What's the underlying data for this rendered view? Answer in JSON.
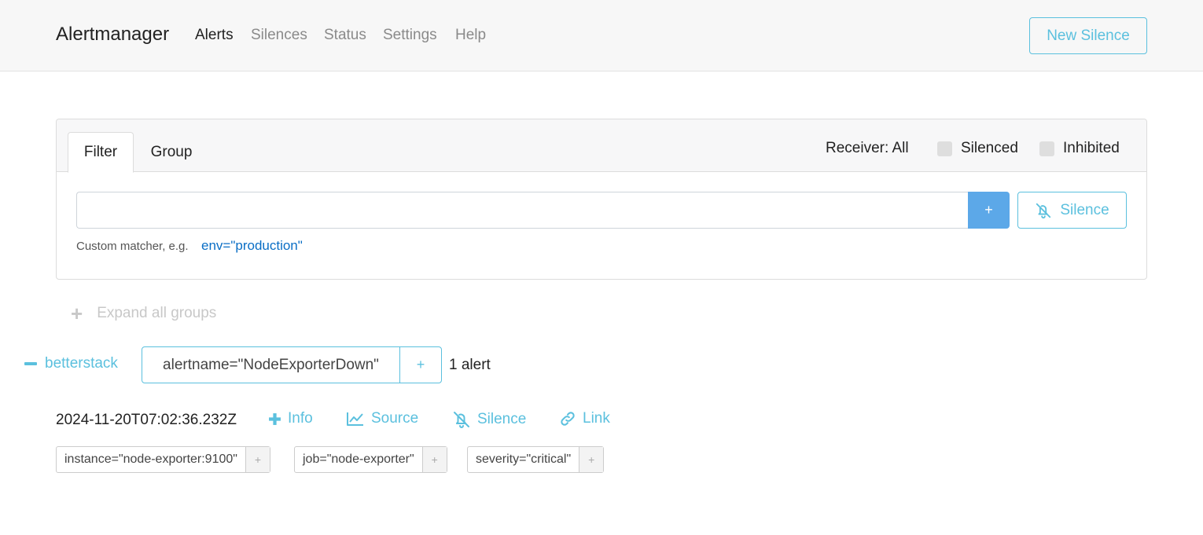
{
  "header": {
    "brand": "Alertmanager",
    "nav": [
      {
        "label": "Alerts",
        "active": true
      },
      {
        "label": "Silences",
        "active": false
      },
      {
        "label": "Status",
        "active": false
      },
      {
        "label": "Settings",
        "active": false
      },
      {
        "label": "Help",
        "active": false
      }
    ],
    "new_silence_label": "New Silence"
  },
  "filter_card": {
    "tabs": [
      {
        "label": "Filter",
        "active": true
      },
      {
        "label": "Group",
        "active": false
      }
    ],
    "receiver_label": "Receiver: All",
    "silenced_label": "Silenced",
    "inhibited_label": "Inhibited",
    "input_value": "",
    "input_placeholder": "",
    "add_button_label": "+",
    "silence_button_label": "Silence",
    "hint_text": "Custom matcher, e.g.",
    "hint_example": "env=\"production\""
  },
  "expand_all_label": "Expand all groups",
  "group": {
    "receiver": "betterstack",
    "label": "alertname=\"NodeExporterDown\"",
    "add_label": "+",
    "count": "1 alert"
  },
  "alert": {
    "timestamp": "2024-11-20T07:02:36.232Z",
    "actions": [
      {
        "label": "Info",
        "icon": "plus-icon"
      },
      {
        "label": "Source",
        "icon": "chart-line-icon"
      },
      {
        "label": "Silence",
        "icon": "bell-slash-icon"
      },
      {
        "label": "Link",
        "icon": "link-icon"
      }
    ],
    "labels": [
      {
        "text": "instance=\"node-exporter:9100\"",
        "add": "+"
      },
      {
        "text": "job=\"node-exporter\"",
        "add": "+"
      },
      {
        "text": "severity=\"critical\"",
        "add": "+"
      }
    ]
  },
  "colors": {
    "accent": "#5bc0de",
    "primary_button": "#5ca8e8",
    "link": "#0a6ec5"
  }
}
